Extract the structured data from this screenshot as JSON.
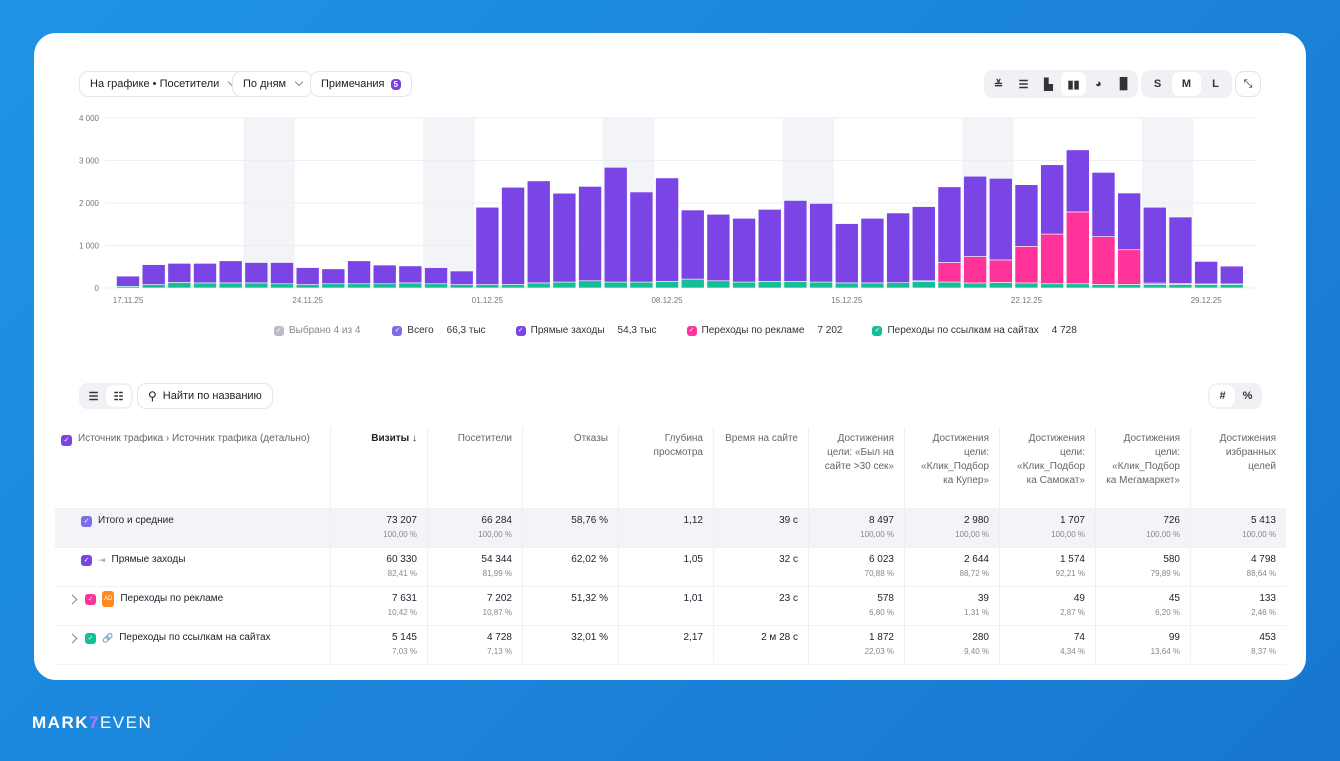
{
  "toolbar": {
    "chart_metric": "На графике • Посетители",
    "grouping": "По дням",
    "notes_label": "Примечания",
    "notes_count": "5",
    "chart_types": [
      "line-stacked-icon",
      "area-stacked-icon",
      "bar-icon",
      "bar-stacked-icon",
      "pie-icon",
      "bar-grouped-icon"
    ],
    "sizes": [
      "S",
      "M",
      "L"
    ],
    "selected_size": "M",
    "collapse": "collapse-icon"
  },
  "colors": {
    "direct": "#7b45e6",
    "ads": "#ff3399",
    "links": "#14bf96",
    "weekend": "#f3f4f8"
  },
  "chart_data": {
    "type": "bar",
    "stacked": true,
    "ylim": [
      0,
      4000
    ],
    "yticks": [
      "0",
      "1 000",
      "2 000",
      "3 000",
      "4 000"
    ],
    "xtick_labels": [
      "17.11.25",
      "24.11.25",
      "01.12.25",
      "08.12.25",
      "15.12.25",
      "22.12.25",
      "29.12.25"
    ],
    "dates": [
      "17.11",
      "18.11",
      "19.11",
      "20.11",
      "21.11",
      "22.11",
      "23.11",
      "24.11",
      "25.11",
      "26.11",
      "27.11",
      "28.11",
      "29.11",
      "30.11",
      "01.12",
      "02.12",
      "03.12",
      "04.12",
      "05.12",
      "06.12",
      "07.12",
      "08.12",
      "09.12",
      "10.12",
      "11.12",
      "12.12",
      "13.12",
      "14.12",
      "15.12",
      "16.12",
      "17.12",
      "18.12",
      "19.12",
      "20.12",
      "21.12",
      "22.12",
      "23.12",
      "24.12",
      "25.12",
      "26.12",
      "27.12",
      "28.12",
      "29.12",
      "30.12"
    ],
    "weekends": [
      "22.11",
      "23.11",
      "29.11",
      "30.11",
      "06.12",
      "07.12",
      "13.12",
      "14.12",
      "20.12",
      "21.12",
      "27.12",
      "28.12"
    ],
    "series": [
      {
        "name": "Переходы по ссылкам на сайтах",
        "values": [
          40,
          80,
          130,
          120,
          120,
          120,
          100,
          80,
          100,
          100,
          100,
          120,
          100,
          80,
          80,
          85,
          120,
          140,
          170,
          140,
          140,
          155,
          210,
          170,
          140,
          155,
          155,
          140,
          120,
          120,
          125,
          150,
          140,
          120,
          130,
          120,
          100,
          100,
          85,
          85,
          85,
          85,
          85,
          85
        ]
      },
      {
        "name": "Переходы по рекламе",
        "values": [
          0,
          0,
          0,
          0,
          0,
          0,
          0,
          0,
          0,
          0,
          0,
          0,
          0,
          0,
          0,
          0,
          0,
          0,
          0,
          0,
          0,
          0,
          0,
          0,
          0,
          0,
          0,
          0,
          0,
          0,
          0,
          20,
          460,
          620,
          530,
          860,
          1170,
          1690,
          1125,
          815,
          30,
          20,
          10,
          10
        ]
      },
      {
        "name": "Прямые заходы",
        "values": [
          240,
          470,
          450,
          460,
          520,
          480,
          500,
          400,
          350,
          540,
          440,
          400,
          380,
          320,
          1820,
          2285,
          2400,
          2090,
          2220,
          2700,
          2120,
          2435,
          1625,
          1565,
          1500,
          1695,
          1905,
          1850,
          1395,
          1520,
          1640,
          1745,
          1780,
          1890,
          1920,
          1450,
          1630,
          1460,
          1510,
          1335,
          1785,
          1565,
          530,
          420
        ]
      }
    ]
  },
  "legend": {
    "selected": "Выбрано 4 из 4",
    "items": [
      {
        "label": "Всего",
        "value": "66,3 тыс",
        "color": "#7b6ee6"
      },
      {
        "label": "Прямые заходы",
        "value": "54,3 тыс",
        "color": "#7b45e6"
      },
      {
        "label": "Переходы по рекламе",
        "value": "7 202",
        "color": "#ff3399"
      },
      {
        "label": "Переходы по ссылкам на сайтах",
        "value": "4 728",
        "color": "#14bf96"
      }
    ]
  },
  "table_toolbar": {
    "search_placeholder": "Найти по названию",
    "abs": "#",
    "pct": "%"
  },
  "table": {
    "headers": [
      "Источник трафика › Источник трафика (детально)",
      "Визиты ↓",
      "Посетители",
      "Отказы",
      "Глубина просмотра",
      "Время на сайте",
      "Достижения цели: «Был на сайте >30 сек»",
      "Достижения цели: «Клик_Подбор ка Купер»",
      "Достижения цели: «Клик_Подбор ка Самокат»",
      "Достижения цели: «Клик_Подбор ка Мегамаркет»",
      "Достижения избранных целей"
    ],
    "rows": [
      {
        "name": "Итого и средние",
        "color": "#7b6ee6",
        "icon": "",
        "cells": [
          [
            "73 207",
            "100,00 %"
          ],
          [
            "66 284",
            "100,00 %"
          ],
          [
            "58,76 %",
            ""
          ],
          [
            "1,12",
            ""
          ],
          [
            "39 с",
            ""
          ],
          [
            "8 497",
            "100,00 %"
          ],
          [
            "2 980",
            "100,00 %"
          ],
          [
            "1 707",
            "100,00 %"
          ],
          [
            "726",
            "100,00 %"
          ],
          [
            "5 413",
            "100,00 %"
          ]
        ]
      },
      {
        "name": "Прямые заходы",
        "color": "#7b45e6",
        "icon": "direct-entry-icon",
        "cells": [
          [
            "60 330",
            "82,41 %"
          ],
          [
            "54 344",
            "81,99 %"
          ],
          [
            "62,02 %",
            ""
          ],
          [
            "1,05",
            ""
          ],
          [
            "32 с",
            ""
          ],
          [
            "6 023",
            "70,88 %"
          ],
          [
            "2 644",
            "88,72 %"
          ],
          [
            "1 574",
            "92,21 %"
          ],
          [
            "580",
            "79,89 %"
          ],
          [
            "4 798",
            "88,64 %"
          ]
        ]
      },
      {
        "name": "Переходы по рекламе",
        "color": "#ff3399",
        "icon": "ad-icon",
        "cells": [
          [
            "7 631",
            "10,42 %"
          ],
          [
            "7 202",
            "10,87 %"
          ],
          [
            "51,32 %",
            ""
          ],
          [
            "1,01",
            ""
          ],
          [
            "23 с",
            ""
          ],
          [
            "578",
            "6,80 %"
          ],
          [
            "39",
            "1,31 %"
          ],
          [
            "49",
            "2,87 %"
          ],
          [
            "45",
            "6,20 %"
          ],
          [
            "133",
            "2,46 %"
          ]
        ]
      },
      {
        "name": "Переходы по ссылкам на сайтах",
        "color": "#14bf96",
        "icon": "link-icon",
        "cells": [
          [
            "5 145",
            "7,03 %"
          ],
          [
            "4 728",
            "7,13 %"
          ],
          [
            "32,01 %",
            ""
          ],
          [
            "2,17",
            ""
          ],
          [
            "2 м 28 с",
            ""
          ],
          [
            "1 872",
            "22,03 %"
          ],
          [
            "280",
            "9,40 %"
          ],
          [
            "74",
            "4,34 %"
          ],
          [
            "99",
            "13,64 %"
          ],
          [
            "453",
            "8,37 %"
          ]
        ]
      }
    ]
  },
  "brand": {
    "a": "MARK",
    "b": "7",
    "c": "EVEN"
  }
}
